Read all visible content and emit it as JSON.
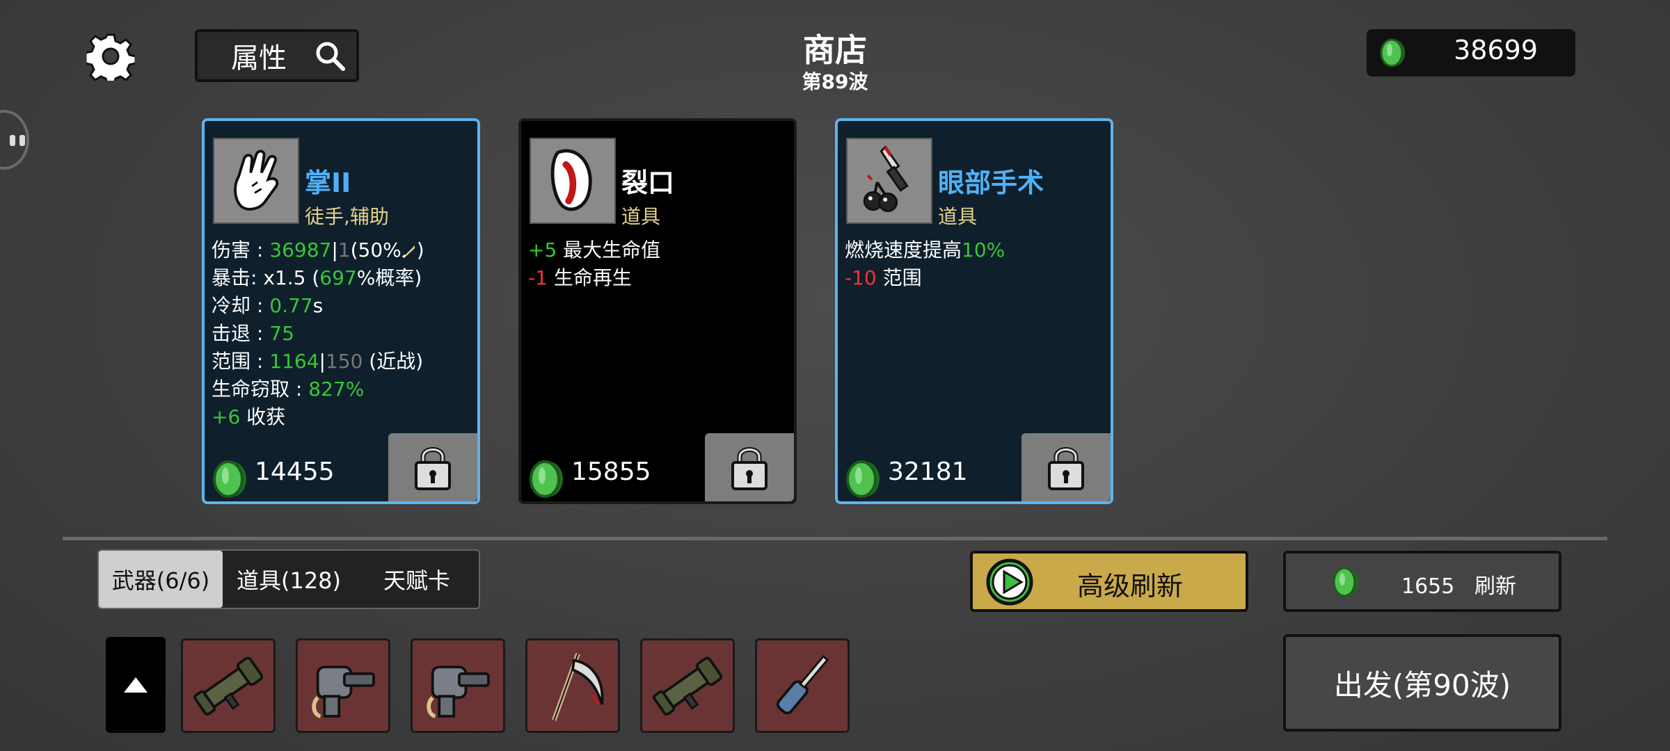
{
  "header": {
    "title": "商店",
    "wave": "第89波",
    "attr_label": "属性",
    "money": "38699"
  },
  "cards": [
    {
      "name": "掌II",
      "type": "徒手,辅助",
      "price": "14455",
      "stats": {
        "damage_label": "伤害 : ",
        "damage_val": "36987",
        "damage_bar": "|",
        "damage_base": "1",
        "damage_scale": "(50%",
        "damage_close": ")",
        "crit_label": "暴击:  x1.5  (",
        "crit_val": "697",
        "crit_suffix": "%概率)",
        "cd_label": "冷却 : ",
        "cd_val": "0.77",
        "cd_unit": "s",
        "kb_label": "击退 : ",
        "kb_val": "75",
        "range_label": "范围 : ",
        "range_val": "1164",
        "range_bar": "|",
        "range_base": "150",
        "range_suffix": " (近战)",
        "ls_label": "生命窃取 : ",
        "ls_val": "827%",
        "harvest_val": "+6",
        "harvest_label": " 收获"
      }
    },
    {
      "name": "裂口",
      "type": "道具",
      "price": "15855",
      "stats": {
        "l1_val": "+5",
        "l1_label": " 最大生命值",
        "l2_val": "-1",
        "l2_label": " 生命再生"
      }
    },
    {
      "name": "眼部手术",
      "type": "道具",
      "price": "32181",
      "stats": {
        "l1_label": "燃烧速度提高",
        "l1_val": "10%",
        "l2_val": "-10",
        "l2_label": " 范围"
      }
    }
  ],
  "tabs": [
    "武器(6/6)",
    "道具(128)",
    "天赋卡"
  ],
  "buttons": {
    "advanced_refresh": "高级刷新",
    "refresh_cost": "1655",
    "refresh_label": "刷新",
    "depart": "出发(第90波)"
  },
  "weapon_slots": [
    "rocket-launcher-icon",
    "gauntlet-gun-icon",
    "gauntlet-gun-icon",
    "scythe-icon",
    "rocket-launcher-icon",
    "screwdriver-icon"
  ],
  "colors": {
    "rarity_blue": "#5db4ee",
    "stat_positive": "#35c935",
    "stat_negative": "#ff3030",
    "item_type": "#e6d28a",
    "advanced_refresh_bg": "#caa94a",
    "slot_bg": "#6b3434"
  }
}
